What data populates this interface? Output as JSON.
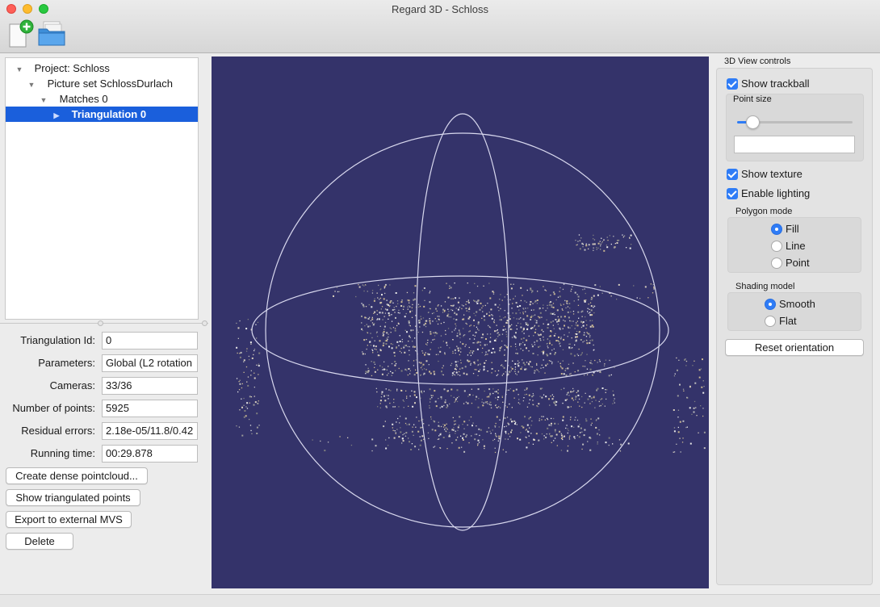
{
  "window": {
    "title": "Regard 3D - Schloss"
  },
  "toolbar": {
    "new_project_icon": "new-document-icon",
    "open_project_icon": "open-folder-icon"
  },
  "tree": {
    "items": [
      {
        "label": "Project: Schloss",
        "expanded": true,
        "selected": false
      },
      {
        "label": "Picture set SchlossDurlach",
        "expanded": true,
        "selected": false
      },
      {
        "label": "Matches 0",
        "expanded": true,
        "selected": false
      },
      {
        "label": "Triangulation 0",
        "expanded": false,
        "selected": true
      }
    ]
  },
  "properties": [
    {
      "label": "Triangulation Id:",
      "value": "0"
    },
    {
      "label": "Parameters:",
      "value": "Global (L2 rotation"
    },
    {
      "label": "Cameras:",
      "value": "33/36"
    },
    {
      "label": "Number of points:",
      "value": "5925"
    },
    {
      "label": "Residual errors:",
      "value": "2.18e-05/11.8/0.42"
    },
    {
      "label": "Running time:",
      "value": "00:29.878"
    }
  ],
  "actions": {
    "create_dense": "Create dense pointcloud...",
    "show_points": "Show triangulated points",
    "export_mvs": "Export to external MVS",
    "delete": "Delete"
  },
  "view3d": {
    "background_color": "#34336a",
    "trackball_color": "#d8d8ee"
  },
  "controls": {
    "title": "3D View controls",
    "show_trackball": {
      "label": "Show trackball",
      "checked": true
    },
    "point_size": {
      "label": "Point size",
      "value": 0.13,
      "text": ""
    },
    "show_texture": {
      "label": "Show texture",
      "checked": true
    },
    "enable_lighting": {
      "label": "Enable lighting",
      "checked": true
    },
    "polygon_mode": {
      "label": "Polygon mode",
      "options": [
        "Fill",
        "Line",
        "Point"
      ],
      "selected": "Fill"
    },
    "shading_model": {
      "label": "Shading model",
      "options": [
        "Smooth",
        "Flat"
      ],
      "selected": "Smooth"
    },
    "reset_orientation": "Reset orientation"
  }
}
